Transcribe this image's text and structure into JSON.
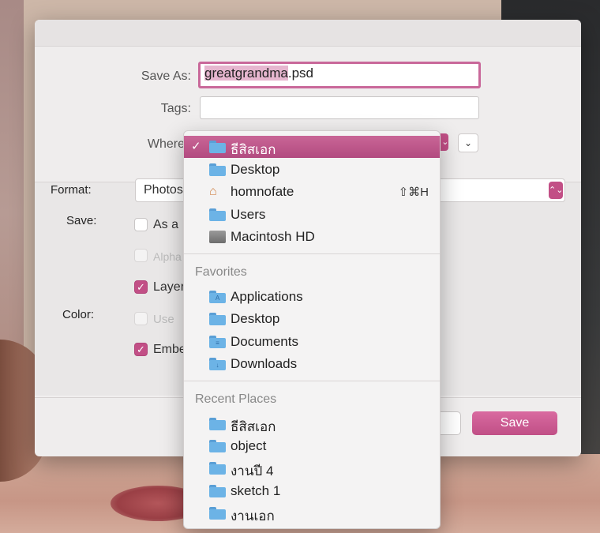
{
  "dialog": {
    "save_as_label": "Save As:",
    "filename_selected": "greatgrandma",
    "filename_ext": ".psd",
    "tags_label": "Tags:",
    "tags_value": "",
    "where_label": "Where",
    "format_label": "Format:",
    "format_value": "Photos",
    "save_label": "Save:",
    "color_label": "Color:",
    "options": [
      {
        "label": "As a",
        "checked": false,
        "disabled": false
      },
      {
        "label": "Alpha",
        "checked": false,
        "disabled": true
      },
      {
        "label": "Layer",
        "checked": true,
        "disabled": false
      },
      {
        "label": "Use",
        "checked": false,
        "disabled": true
      },
      {
        "label": "Embe",
        "checked": true,
        "disabled": false
      }
    ],
    "save_button": "Save",
    "accent_color": "#c24f86"
  },
  "where_menu": {
    "current": {
      "label": "ธีสิสเอก",
      "icon": "folder-icon"
    },
    "locations": [
      {
        "label": "Desktop",
        "icon": "folder-icon"
      },
      {
        "label": "homnofate",
        "icon": "home-icon",
        "shortcut": "⇧⌘H"
      },
      {
        "label": "Users",
        "icon": "folder-icon"
      },
      {
        "label": "Macintosh HD",
        "icon": "disk-icon"
      }
    ],
    "favorites_header": "Favorites",
    "favorites": [
      {
        "label": "Applications",
        "icon": "applications-folder-icon"
      },
      {
        "label": "Desktop",
        "icon": "folder-icon"
      },
      {
        "label": "Documents",
        "icon": "documents-folder-icon"
      },
      {
        "label": "Downloads",
        "icon": "downloads-folder-icon"
      }
    ],
    "recent_header": "Recent Places",
    "recent": [
      {
        "label": "ธีสิสเอก",
        "icon": "folder-icon"
      },
      {
        "label": "object",
        "icon": "folder-icon"
      },
      {
        "label": "งานปี 4",
        "icon": "folder-icon"
      },
      {
        "label": "sketch 1",
        "icon": "folder-icon"
      },
      {
        "label": "งานเอก",
        "icon": "folder-icon"
      }
    ]
  },
  "glyphs": {
    "check": "✓",
    "stepper": "⌃⌄",
    "chevron_down": "⌄",
    "home": "⌂"
  }
}
